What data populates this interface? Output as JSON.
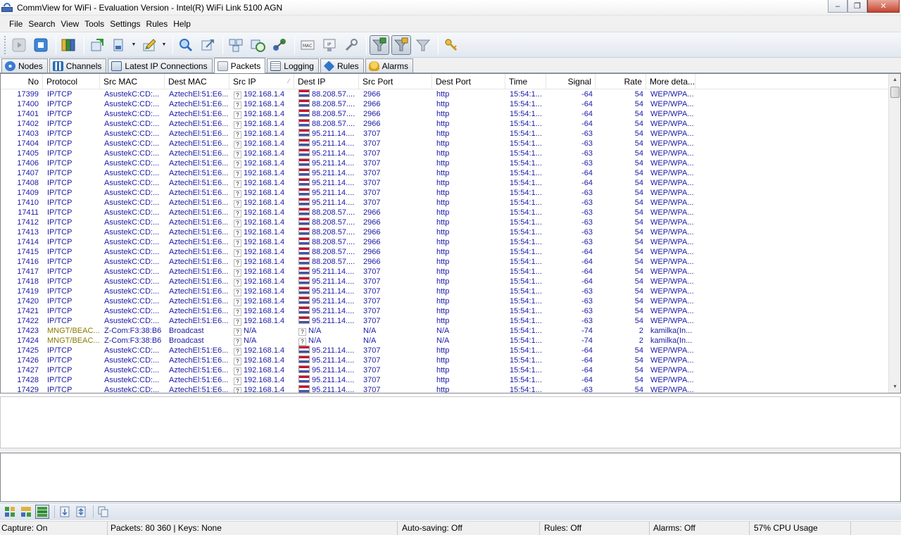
{
  "window": {
    "title": "CommView for WiFi - Evaluation Version - Intel(R) WiFi Link 5100 AGN",
    "minimize": "‒",
    "maximize": "❐",
    "close": "✕"
  },
  "menu": [
    "File",
    "Search",
    "View",
    "Tools",
    "Settings",
    "Rules",
    "Help"
  ],
  "tabs": [
    {
      "label": "Nodes",
      "icon": "nodes-icon",
      "color": "#3a7bd5"
    },
    {
      "label": "Channels",
      "icon": "channels-icon",
      "color": "#2b6cb0"
    },
    {
      "label": "Latest IP Connections",
      "icon": "connections-icon",
      "color": "#3b5f9e"
    },
    {
      "label": "Packets",
      "icon": "packets-icon",
      "color": "#7d8a99",
      "selected": true
    },
    {
      "label": "Logging",
      "icon": "logging-icon",
      "color": "#6a7b8f"
    },
    {
      "label": "Rules",
      "icon": "rules-icon",
      "color": "#2f77c9"
    },
    {
      "label": "Alarms",
      "icon": "alarms-icon",
      "color": "#d9a21b"
    }
  ],
  "columns": [
    "No",
    "Protocol",
    "Src MAC",
    "Dest MAC",
    "Src IP",
    "Dest IP",
    "Src Port",
    "Dest Port",
    "Time",
    "Signal",
    "Rate",
    "More deta..."
  ],
  "sort_indicator": "⁄",
  "packets": [
    {
      "no": "17399",
      "proto": "IP/TCP",
      "src_mac": "AsustekC:CD:...",
      "dest_mac": "AztechEl:51:E6...",
      "src_ip": "192.168.1.4",
      "dest_ip": "88.208.57....",
      "src_port": "2966",
      "dest_port": "http",
      "time": "15:54:1...",
      "signal": "-64",
      "rate": "54",
      "more": "WEP/WPA...",
      "flag": true
    },
    {
      "no": "17400",
      "proto": "IP/TCP",
      "src_mac": "AsustekC:CD:...",
      "dest_mac": "AztechEl:51:E6...",
      "src_ip": "192.168.1.4",
      "dest_ip": "88.208.57....",
      "src_port": "2966",
      "dest_port": "http",
      "time": "15:54:1...",
      "signal": "-64",
      "rate": "54",
      "more": "WEP/WPA...",
      "flag": true
    },
    {
      "no": "17401",
      "proto": "IP/TCP",
      "src_mac": "AsustekC:CD:...",
      "dest_mac": "AztechEl:51:E6...",
      "src_ip": "192.168.1.4",
      "dest_ip": "88.208.57....",
      "src_port": "2966",
      "dest_port": "http",
      "time": "15:54:1...",
      "signal": "-64",
      "rate": "54",
      "more": "WEP/WPA...",
      "flag": true
    },
    {
      "no": "17402",
      "proto": "IP/TCP",
      "src_mac": "AsustekC:CD:...",
      "dest_mac": "AztechEl:51:E6...",
      "src_ip": "192.168.1.4",
      "dest_ip": "88.208.57....",
      "src_port": "2966",
      "dest_port": "http",
      "time": "15:54:1...",
      "signal": "-64",
      "rate": "54",
      "more": "WEP/WPA...",
      "flag": true
    },
    {
      "no": "17403",
      "proto": "IP/TCP",
      "src_mac": "AsustekC:CD:...",
      "dest_mac": "AztechEl:51:E6...",
      "src_ip": "192.168.1.4",
      "dest_ip": "95.211.14....",
      "src_port": "3707",
      "dest_port": "http",
      "time": "15:54:1...",
      "signal": "-63",
      "rate": "54",
      "more": "WEP/WPA...",
      "flag": true
    },
    {
      "no": "17404",
      "proto": "IP/TCP",
      "src_mac": "AsustekC:CD:...",
      "dest_mac": "AztechEl:51:E6...",
      "src_ip": "192.168.1.4",
      "dest_ip": "95.211.14....",
      "src_port": "3707",
      "dest_port": "http",
      "time": "15:54:1...",
      "signal": "-63",
      "rate": "54",
      "more": "WEP/WPA...",
      "flag": true
    },
    {
      "no": "17405",
      "proto": "IP/TCP",
      "src_mac": "AsustekC:CD:...",
      "dest_mac": "AztechEl:51:E6...",
      "src_ip": "192.168.1.4",
      "dest_ip": "95.211.14....",
      "src_port": "3707",
      "dest_port": "http",
      "time": "15:54:1...",
      "signal": "-63",
      "rate": "54",
      "more": "WEP/WPA...",
      "flag": true
    },
    {
      "no": "17406",
      "proto": "IP/TCP",
      "src_mac": "AsustekC:CD:...",
      "dest_mac": "AztechEl:51:E6...",
      "src_ip": "192.168.1.4",
      "dest_ip": "95.211.14....",
      "src_port": "3707",
      "dest_port": "http",
      "time": "15:54:1...",
      "signal": "-63",
      "rate": "54",
      "more": "WEP/WPA...",
      "flag": true
    },
    {
      "no": "17407",
      "proto": "IP/TCP",
      "src_mac": "AsustekC:CD:...",
      "dest_mac": "AztechEl:51:E6...",
      "src_ip": "192.168.1.4",
      "dest_ip": "95.211.14....",
      "src_port": "3707",
      "dest_port": "http",
      "time": "15:54:1...",
      "signal": "-64",
      "rate": "54",
      "more": "WEP/WPA...",
      "flag": true
    },
    {
      "no": "17408",
      "proto": "IP/TCP",
      "src_mac": "AsustekC:CD:...",
      "dest_mac": "AztechEl:51:E6...",
      "src_ip": "192.168.1.4",
      "dest_ip": "95.211.14....",
      "src_port": "3707",
      "dest_port": "http",
      "time": "15:54:1...",
      "signal": "-64",
      "rate": "54",
      "more": "WEP/WPA...",
      "flag": true
    },
    {
      "no": "17409",
      "proto": "IP/TCP",
      "src_mac": "AsustekC:CD:...",
      "dest_mac": "AztechEl:51:E6...",
      "src_ip": "192.168.1.4",
      "dest_ip": "95.211.14....",
      "src_port": "3707",
      "dest_port": "http",
      "time": "15:54:1...",
      "signal": "-63",
      "rate": "54",
      "more": "WEP/WPA...",
      "flag": true
    },
    {
      "no": "17410",
      "proto": "IP/TCP",
      "src_mac": "AsustekC:CD:...",
      "dest_mac": "AztechEl:51:E6...",
      "src_ip": "192.168.1.4",
      "dest_ip": "95.211.14....",
      "src_port": "3707",
      "dest_port": "http",
      "time": "15:54:1...",
      "signal": "-63",
      "rate": "54",
      "more": "WEP/WPA...",
      "flag": true
    },
    {
      "no": "17411",
      "proto": "IP/TCP",
      "src_mac": "AsustekC:CD:...",
      "dest_mac": "AztechEl:51:E6...",
      "src_ip": "192.168.1.4",
      "dest_ip": "88.208.57....",
      "src_port": "2966",
      "dest_port": "http",
      "time": "15:54:1...",
      "signal": "-63",
      "rate": "54",
      "more": "WEP/WPA...",
      "flag": true
    },
    {
      "no": "17412",
      "proto": "IP/TCP",
      "src_mac": "AsustekC:CD:...",
      "dest_mac": "AztechEl:51:E6...",
      "src_ip": "192.168.1.4",
      "dest_ip": "88.208.57....",
      "src_port": "2966",
      "dest_port": "http",
      "time": "15:54:1...",
      "signal": "-63",
      "rate": "54",
      "more": "WEP/WPA...",
      "flag": true
    },
    {
      "no": "17413",
      "proto": "IP/TCP",
      "src_mac": "AsustekC:CD:...",
      "dest_mac": "AztechEl:51:E6...",
      "src_ip": "192.168.1.4",
      "dest_ip": "88.208.57....",
      "src_port": "2966",
      "dest_port": "http",
      "time": "15:54:1...",
      "signal": "-63",
      "rate": "54",
      "more": "WEP/WPA...",
      "flag": true
    },
    {
      "no": "17414",
      "proto": "IP/TCP",
      "src_mac": "AsustekC:CD:...",
      "dest_mac": "AztechEl:51:E6...",
      "src_ip": "192.168.1.4",
      "dest_ip": "88.208.57....",
      "src_port": "2966",
      "dest_port": "http",
      "time": "15:54:1...",
      "signal": "-63",
      "rate": "54",
      "more": "WEP/WPA...",
      "flag": true
    },
    {
      "no": "17415",
      "proto": "IP/TCP",
      "src_mac": "AsustekC:CD:...",
      "dest_mac": "AztechEl:51:E6...",
      "src_ip": "192.168.1.4",
      "dest_ip": "88.208.57....",
      "src_port": "2966",
      "dest_port": "http",
      "time": "15:54:1...",
      "signal": "-64",
      "rate": "54",
      "more": "WEP/WPA...",
      "flag": true
    },
    {
      "no": "17416",
      "proto": "IP/TCP",
      "src_mac": "AsustekC:CD:...",
      "dest_mac": "AztechEl:51:E6...",
      "src_ip": "192.168.1.4",
      "dest_ip": "88.208.57....",
      "src_port": "2966",
      "dest_port": "http",
      "time": "15:54:1...",
      "signal": "-64",
      "rate": "54",
      "more": "WEP/WPA...",
      "flag": true
    },
    {
      "no": "17417",
      "proto": "IP/TCP",
      "src_mac": "AsustekC:CD:...",
      "dest_mac": "AztechEl:51:E6...",
      "src_ip": "192.168.1.4",
      "dest_ip": "95.211.14....",
      "src_port": "3707",
      "dest_port": "http",
      "time": "15:54:1...",
      "signal": "-64",
      "rate": "54",
      "more": "WEP/WPA...",
      "flag": true
    },
    {
      "no": "17418",
      "proto": "IP/TCP",
      "src_mac": "AsustekC:CD:...",
      "dest_mac": "AztechEl:51:E6...",
      "src_ip": "192.168.1.4",
      "dest_ip": "95.211.14....",
      "src_port": "3707",
      "dest_port": "http",
      "time": "15:54:1...",
      "signal": "-64",
      "rate": "54",
      "more": "WEP/WPA...",
      "flag": true
    },
    {
      "no": "17419",
      "proto": "IP/TCP",
      "src_mac": "AsustekC:CD:...",
      "dest_mac": "AztechEl:51:E6...",
      "src_ip": "192.168.1.4",
      "dest_ip": "95.211.14....",
      "src_port": "3707",
      "dest_port": "http",
      "time": "15:54:1...",
      "signal": "-63",
      "rate": "54",
      "more": "WEP/WPA...",
      "flag": true
    },
    {
      "no": "17420",
      "proto": "IP/TCP",
      "src_mac": "AsustekC:CD:...",
      "dest_mac": "AztechEl:51:E6...",
      "src_ip": "192.168.1.4",
      "dest_ip": "95.211.14....",
      "src_port": "3707",
      "dest_port": "http",
      "time": "15:54:1...",
      "signal": "-63",
      "rate": "54",
      "more": "WEP/WPA...",
      "flag": true
    },
    {
      "no": "17421",
      "proto": "IP/TCP",
      "src_mac": "AsustekC:CD:...",
      "dest_mac": "AztechEl:51:E6...",
      "src_ip": "192.168.1.4",
      "dest_ip": "95.211.14....",
      "src_port": "3707",
      "dest_port": "http",
      "time": "15:54:1...",
      "signal": "-63",
      "rate": "54",
      "more": "WEP/WPA...",
      "flag": true
    },
    {
      "no": "17422",
      "proto": "IP/TCP",
      "src_mac": "AsustekC:CD:...",
      "dest_mac": "AztechEl:51:E6...",
      "src_ip": "192.168.1.4",
      "dest_ip": "95.211.14....",
      "src_port": "3707",
      "dest_port": "http",
      "time": "15:54:1...",
      "signal": "-63",
      "rate": "54",
      "more": "WEP/WPA...",
      "flag": true
    },
    {
      "no": "17423",
      "proto": "MNGT/BEAC...",
      "src_mac": "Z-Com:F3:38:B6",
      "dest_mac": "Broadcast",
      "src_ip": "N/A",
      "dest_ip": "N/A",
      "src_port": "N/A",
      "dest_port": "N/A",
      "time": "15:54:1...",
      "signal": "-74",
      "rate": "2",
      "more": "kamilka(In...",
      "flag": false,
      "mngt": true
    },
    {
      "no": "17424",
      "proto": "MNGT/BEAC...",
      "src_mac": "Z-Com:F3:38:B6",
      "dest_mac": "Broadcast",
      "src_ip": "N/A",
      "dest_ip": "N/A",
      "src_port": "N/A",
      "dest_port": "N/A",
      "time": "15:54:1...",
      "signal": "-74",
      "rate": "2",
      "more": "kamilka(In...",
      "flag": false,
      "mngt": true
    },
    {
      "no": "17425",
      "proto": "IP/TCP",
      "src_mac": "AsustekC:CD:...",
      "dest_mac": "AztechEl:51:E6...",
      "src_ip": "192.168.1.4",
      "dest_ip": "95.211.14....",
      "src_port": "3707",
      "dest_port": "http",
      "time": "15:54:1...",
      "signal": "-64",
      "rate": "54",
      "more": "WEP/WPA...",
      "flag": true
    },
    {
      "no": "17426",
      "proto": "IP/TCP",
      "src_mac": "AsustekC:CD:...",
      "dest_mac": "AztechEl:51:E6...",
      "src_ip": "192.168.1.4",
      "dest_ip": "95.211.14....",
      "src_port": "3707",
      "dest_port": "http",
      "time": "15:54:1...",
      "signal": "-64",
      "rate": "54",
      "more": "WEP/WPA...",
      "flag": true
    },
    {
      "no": "17427",
      "proto": "IP/TCP",
      "src_mac": "AsustekC:CD:...",
      "dest_mac": "AztechEl:51:E6...",
      "src_ip": "192.168.1.4",
      "dest_ip": "95.211.14....",
      "src_port": "3707",
      "dest_port": "http",
      "time": "15:54:1...",
      "signal": "-64",
      "rate": "54",
      "more": "WEP/WPA...",
      "flag": true
    },
    {
      "no": "17428",
      "proto": "IP/TCP",
      "src_mac": "AsustekC:CD:...",
      "dest_mac": "AztechEl:51:E6...",
      "src_ip": "192.168.1.4",
      "dest_ip": "95.211.14....",
      "src_port": "3707",
      "dest_port": "http",
      "time": "15:54:1...",
      "signal": "-64",
      "rate": "54",
      "more": "WEP/WPA...",
      "flag": true
    },
    {
      "no": "17429",
      "proto": "IP/TCP",
      "src_mac": "AsustekC:CD:...",
      "dest_mac": "AztechEl:51:E6...",
      "src_ip": "192.168.1.4",
      "dest_ip": "95.211.14....",
      "src_port": "3707",
      "dest_port": "http",
      "time": "15:54:1...",
      "signal": "-63",
      "rate": "54",
      "more": "WEP/WPA...",
      "flag": true
    }
  ],
  "unknown_marker": "?",
  "scroll": {
    "up": "▲",
    "down": "▼"
  },
  "status": {
    "capture": "Capture: On",
    "packets": "Packets: 80 360 | Keys: None",
    "autosave": "Auto-saving: Off",
    "rules": "Rules: Off",
    "alarms": "Alarms: Off",
    "cpu": "57% CPU Usage"
  },
  "colors": {
    "link_blue": "#1a1aa6",
    "mngt_olive": "#8a7a00",
    "toolbar_bg": "#e2e8f0",
    "flag_red": "#c8102e",
    "flag_blue": "#3f55a6"
  },
  "toolbar_icons": [
    "play-icon",
    "stop-icon",
    "open-map-icon",
    "new-window-icon",
    "save-icon",
    "save-dropdown",
    "highlight-icon",
    "highlight-dropdown",
    "search-icon",
    "export-icon",
    "reconstruct-icon",
    "sessions-icon",
    "nodes-reassign-icon",
    "mac-alias-icon",
    "ip-alias-icon",
    "tools-icon",
    "filter-monitor-icon",
    "filter-mac-icon",
    "filter-funnel-icon",
    "keys-icon"
  ],
  "bottom_icons": [
    "tile-icon",
    "split-icon",
    "single-pane-icon",
    "scroll-icon",
    "autoscroll-icon",
    "copy-icon"
  ]
}
